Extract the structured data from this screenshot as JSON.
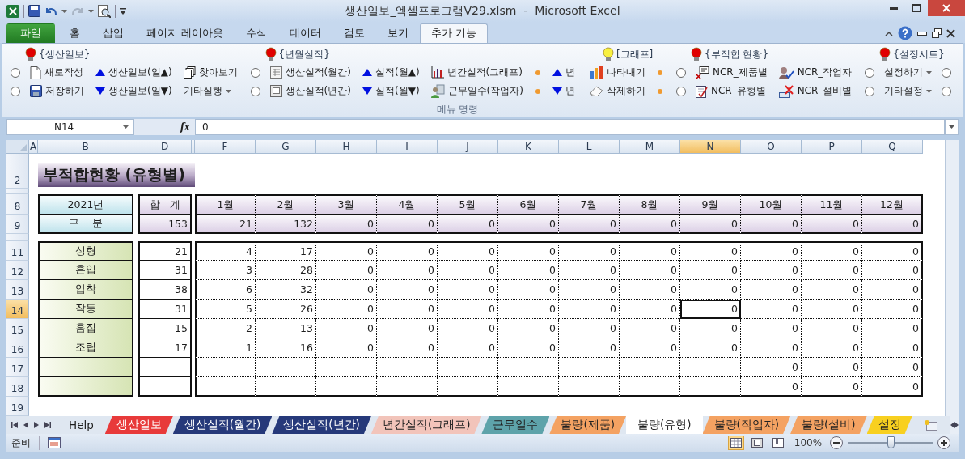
{
  "window": {
    "title": "생산일보_엑셀프로그램V29.xlsm  -  Microsoft Excel"
  },
  "ribbon_tabs": [
    {
      "label": "파일",
      "kind": "file",
      "selected": false
    },
    {
      "label": "홈",
      "kind": "tab",
      "selected": false
    },
    {
      "label": "삽입",
      "kind": "tab",
      "selected": false
    },
    {
      "label": "페이지 레이아웃",
      "kind": "tab",
      "selected": false
    },
    {
      "label": "수식",
      "kind": "tab",
      "selected": false
    },
    {
      "label": "데이터",
      "kind": "tab",
      "selected": false
    },
    {
      "label": "검토",
      "kind": "tab",
      "selected": false
    },
    {
      "label": "보기",
      "kind": "tab",
      "selected": false
    },
    {
      "label": "추가 기능",
      "kind": "tab",
      "selected": true
    }
  ],
  "ribbon": {
    "sections": [
      {
        "header": "{생산일보}",
        "color": "#e00000",
        "columns": [
          [
            {
              "kind": "radio"
            },
            {
              "kind": "radio"
            }
          ],
          [
            {
              "kind": "button",
              "label": "새로작성"
            },
            {
              "kind": "button",
              "label": "저장하기"
            }
          ],
          [
            {
              "kind": "button",
              "label": "생산일보(일▲)"
            },
            {
              "kind": "button",
              "label": "생산일보(일▼)"
            }
          ],
          [
            {
              "kind": "button",
              "label": "찾아보기"
            },
            {
              "kind": "menu",
              "label": "기타실행"
            }
          ]
        ]
      },
      {
        "header": "{년월실적}",
        "color": "#e00000",
        "columns": [
          [
            {
              "kind": "radio"
            },
            {
              "kind": "radio"
            }
          ],
          [
            {
              "kind": "button",
              "label": "생산실적(월간)"
            },
            {
              "kind": "button",
              "label": "생산실적(년간)"
            }
          ],
          [
            {
              "kind": "button",
              "label": "실적(월▲)"
            },
            {
              "kind": "button",
              "label": "실적(월▼)"
            }
          ],
          [
            {
              "kind": "button",
              "label": "년간실적(그래프)"
            },
            {
              "kind": "button",
              "label": "근무일수(작업자)"
            }
          ],
          [
            {
              "kind": "dot"
            },
            {
              "kind": "dot"
            }
          ],
          [
            {
              "kind": "button",
              "label": "년"
            },
            {
              "kind": "button",
              "label": "년"
            }
          ]
        ]
      },
      {
        "header": "[그래프]",
        "color": "#f8f040",
        "columns": [
          [
            {
              "kind": "button",
              "label": "나타내기"
            },
            {
              "kind": "button",
              "label": "삭제하기"
            }
          ],
          [
            {
              "kind": "dot"
            },
            {
              "kind": "dot"
            }
          ]
        ]
      },
      {
        "header": "{부적합 현황}",
        "color": "#e00000",
        "columns": [
          [
            {
              "kind": "radio"
            },
            {
              "kind": "radio"
            }
          ],
          [
            {
              "kind": "button",
              "label": "NCR_제품별"
            },
            {
              "kind": "button",
              "label": "NCR_유형별"
            }
          ],
          [
            {
              "kind": "button",
              "label": "NCR_작업자"
            },
            {
              "kind": "button",
              "label": "NCR_설비별"
            }
          ]
        ]
      },
      {
        "header": "{설정시트}",
        "color": "#e00000",
        "columns": [
          [
            {
              "kind": "radio"
            },
            {
              "kind": "radio"
            }
          ],
          [
            {
              "kind": "menu",
              "label": "설정하기"
            },
            {
              "kind": "menu",
              "label": "기타설정"
            }
          ],
          [
            {
              "kind": "radio"
            },
            {
              "kind": "radio"
            }
          ]
        ]
      }
    ],
    "group_label": "메뉴 명령"
  },
  "formula_bar": {
    "name_box": "N14",
    "function_label": "fx",
    "value": "0"
  },
  "sheet": {
    "columns": [
      {
        "label": "A",
        "selected": false
      },
      {
        "label": "B",
        "selected": false
      },
      {
        "selected": false
      },
      {
        "label": "D",
        "selected": false
      },
      {
        "selected": false
      },
      {
        "label": "F",
        "selected": false
      },
      {
        "label": "G",
        "selected": false
      },
      {
        "label": "H",
        "selected": false
      },
      {
        "label": "I",
        "selected": false
      },
      {
        "label": "J",
        "selected": false
      },
      {
        "label": "K",
        "selected": false
      },
      {
        "label": "L",
        "selected": false
      },
      {
        "label": "M",
        "selected": false
      },
      {
        "label": "N",
        "selected": true
      },
      {
        "label": "O",
        "selected": false
      },
      {
        "label": "P",
        "selected": false
      },
      {
        "label": "Q",
        "selected": false
      }
    ],
    "rows": [
      {
        "selected": false
      },
      {
        "label": "2",
        "selected": false
      },
      {
        "selected": false
      },
      {
        "label": "8",
        "selected": false
      },
      {
        "label": "9",
        "selected": false
      },
      {
        "selected": false
      },
      {
        "label": "11",
        "selected": false
      },
      {
        "label": "12",
        "selected": false
      },
      {
        "label": "13",
        "selected": false
      },
      {
        "label": "14",
        "selected": true
      },
      {
        "label": "15",
        "selected": false
      },
      {
        "label": "16",
        "selected": false
      },
      {
        "label": "17",
        "selected": false
      },
      {
        "label": "18",
        "selected": false
      },
      {
        "label": "19",
        "selected": false
      }
    ],
    "title": "부적합현황 (유형별)",
    "header": {
      "year": "2021년",
      "category": "구    분",
      "total_label": "합   계",
      "total": "153",
      "months": [
        "1월",
        "2월",
        "3월",
        "4월",
        "5월",
        "6월",
        "7월",
        "8월",
        "9월",
        "10월",
        "11월",
        "12월"
      ],
      "month_totals": [
        "21",
        "132",
        "0",
        "0",
        "0",
        "0",
        "0",
        "0",
        "0",
        "0",
        "0",
        "0"
      ]
    },
    "data": [
      {
        "label": "성형",
        "total": "21",
        "values": [
          "4",
          "17",
          "0",
          "0",
          "0",
          "0",
          "0",
          "0",
          "0",
          "0",
          "0",
          "0"
        ]
      },
      {
        "label": "혼입",
        "total": "31",
        "values": [
          "3",
          "28",
          "0",
          "0",
          "0",
          "0",
          "0",
          "0",
          "0",
          "0",
          "0",
          "0"
        ]
      },
      {
        "label": "압착",
        "total": "38",
        "values": [
          "6",
          "32",
          "0",
          "0",
          "0",
          "0",
          "0",
          "0",
          "0",
          "0",
          "0",
          "0"
        ]
      },
      {
        "label": "작동",
        "total": "31",
        "values": [
          "5",
          "26",
          "0",
          "0",
          "0",
          "0",
          "0",
          "0",
          "0",
          "0",
          "0",
          "0"
        ]
      },
      {
        "label": "흠집",
        "total": "15",
        "values": [
          "2",
          "13",
          "0",
          "0",
          "0",
          "0",
          "0",
          "0",
          "0",
          "0",
          "0",
          "0"
        ]
      },
      {
        "label": "조립",
        "total": "17",
        "values": [
          "1",
          "16",
          "0",
          "0",
          "0",
          "0",
          "0",
          "0",
          "0",
          "0",
          "0",
          "0"
        ]
      },
      {
        "values": [
          "0",
          "0",
          "0"
        ]
      },
      {
        "values": [
          "0",
          "0",
          "0"
        ]
      }
    ]
  },
  "sheet_tabs": [
    {
      "label": "Help",
      "selected": false
    },
    {
      "label": "생산일보",
      "color": "#e83a3a",
      "selected": false
    },
    {
      "label": "생산실적(월간)",
      "color": "#26397a",
      "selected": false
    },
    {
      "label": "생산실적(년간)",
      "color": "#26397a",
      "selected": false
    },
    {
      "label": "년간실적(그래프)",
      "color": "#f2c4ba",
      "selected": false
    },
    {
      "label": "근무일수",
      "color": "#5ea3aa",
      "selected": false
    },
    {
      "label": "불량(제품)",
      "color": "#f4a262",
      "selected": false
    },
    {
      "label": "불량(유형)",
      "selected": true
    },
    {
      "label": "불량(작업자)",
      "color": "#f4a262",
      "selected": false
    },
    {
      "label": "불량(설비)",
      "color": "#f4a262",
      "selected": false
    },
    {
      "label": "설정",
      "color": "#f8d020",
      "selected": false
    }
  ],
  "status_bar": {
    "status": "준비",
    "views": [
      {
        "selected": true
      },
      {
        "selected": false
      },
      {
        "selected": false
      }
    ],
    "zoom": "100%",
    "zoom_slider": {
      "level": 0.5
    }
  }
}
